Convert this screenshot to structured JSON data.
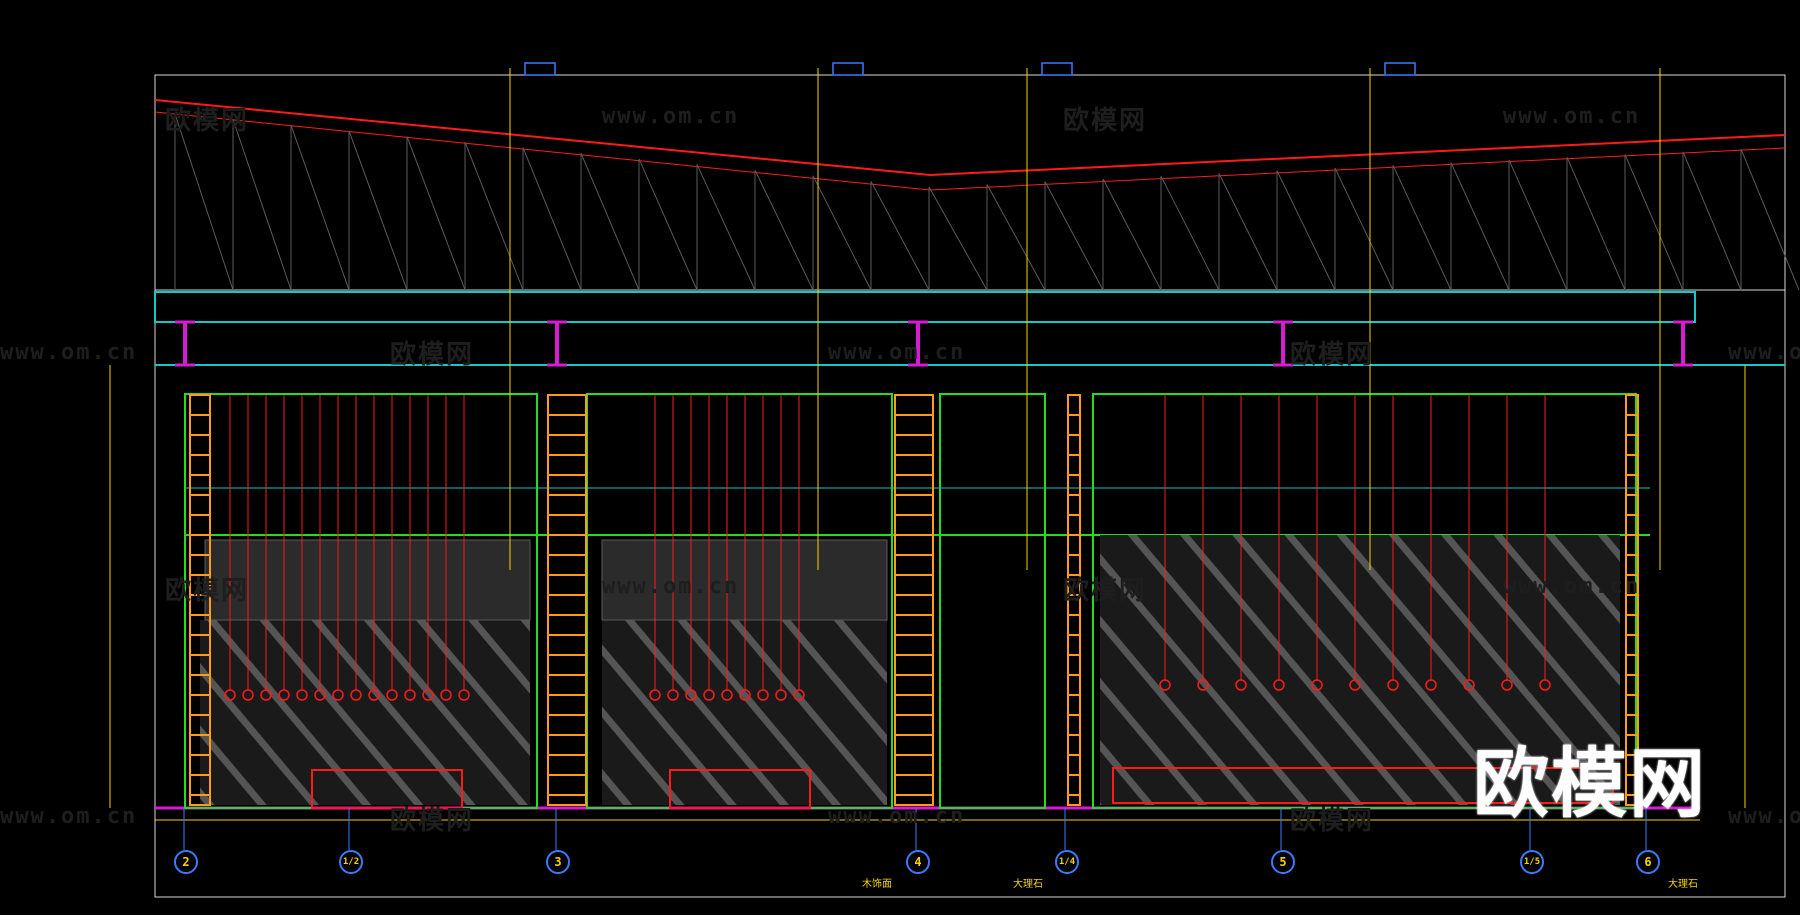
{
  "drawing": {
    "background": "#000000",
    "colors": {
      "red": "#ff1a1a",
      "yellow": "#f4d400",
      "cyan": "#14c8c8",
      "green": "#22dd22",
      "orange": "#ff9a1a",
      "magenta": "#d61ad6",
      "blue": "#3a7bff",
      "white": "#d8d8d8",
      "gray": "#5a5a5a"
    }
  },
  "watermarks": {
    "brand": "欧模网",
    "url": "www.om.cn"
  },
  "logo": "欧模网",
  "grid_axes": [
    "2",
    "1/2",
    "3",
    "4",
    "1/4",
    "5",
    "1/5",
    "6"
  ],
  "callouts": {
    "bottom": [
      {
        "code": "大理石"
      },
      {
        "code": "木饰面"
      },
      {
        "code": "大理石"
      }
    ]
  }
}
